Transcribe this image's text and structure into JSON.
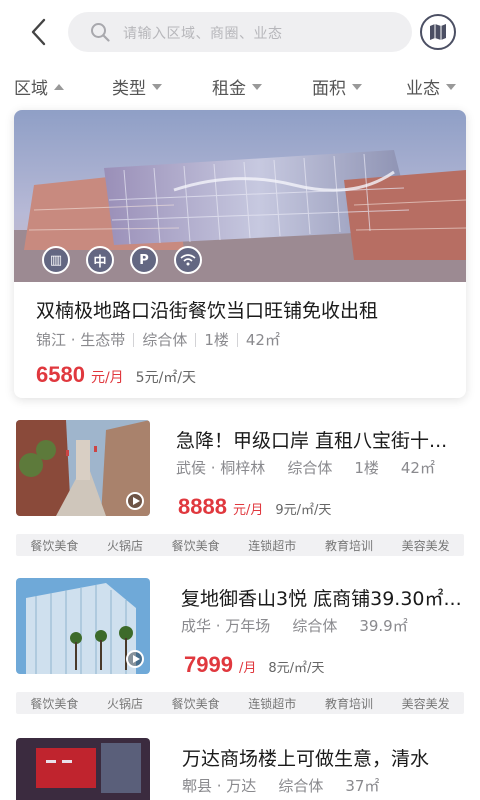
{
  "search": {
    "placeholder": "请输入区域、商圈、业态"
  },
  "filters": [
    {
      "label": "区域",
      "active": true
    },
    {
      "label": "类型"
    },
    {
      "label": "租金"
    },
    {
      "label": "面积"
    },
    {
      "label": "业态"
    }
  ],
  "featured": {
    "title": "双楠极地路口沿街餐饮当口旺铺免收出租",
    "area": "锦江 · 生态带",
    "type": "综合体",
    "floor": "1楼",
    "size": "42㎡",
    "price": "6580",
    "price_unit": "元/月",
    "unit_price": "5元/㎡/天",
    "amenities": [
      "elevator-icon",
      "center-icon",
      "parking-icon",
      "wifi-icon"
    ]
  },
  "listings": [
    {
      "title": "急降！甲级口岸 直租八宝街十...",
      "area": "武侯 · 桐梓林",
      "type": "综合体",
      "floor": "1楼",
      "size": "42㎡",
      "price": "8888",
      "price_unit": "元/月",
      "unit_price": "9元/㎡/天",
      "tags": [
        "餐饮美食",
        "火锅店",
        "餐饮美食",
        "连锁超市",
        "教育培训",
        "美容美发"
      ]
    },
    {
      "title": "复地御香山3悦 底商铺39.30㎡...",
      "area": "成华 · 万年场",
      "type": "综合体",
      "size": "39.9㎡",
      "price": "7999",
      "price_unit": "/月",
      "unit_price": "8元/㎡/天",
      "tags": [
        "餐饮美食",
        "火锅店",
        "餐饮美食",
        "连锁超市",
        "教育培训",
        "美容美发"
      ]
    },
    {
      "title": "万达商场楼上可做生意，清水",
      "area": "郫县 · 万达",
      "type": "综合体",
      "size": "37㎡"
    }
  ],
  "colors": {
    "accent": "#e0383e",
    "text": "#1a1a1a",
    "muted": "#8a8a8e",
    "tag_bg": "#f1f1f3"
  }
}
